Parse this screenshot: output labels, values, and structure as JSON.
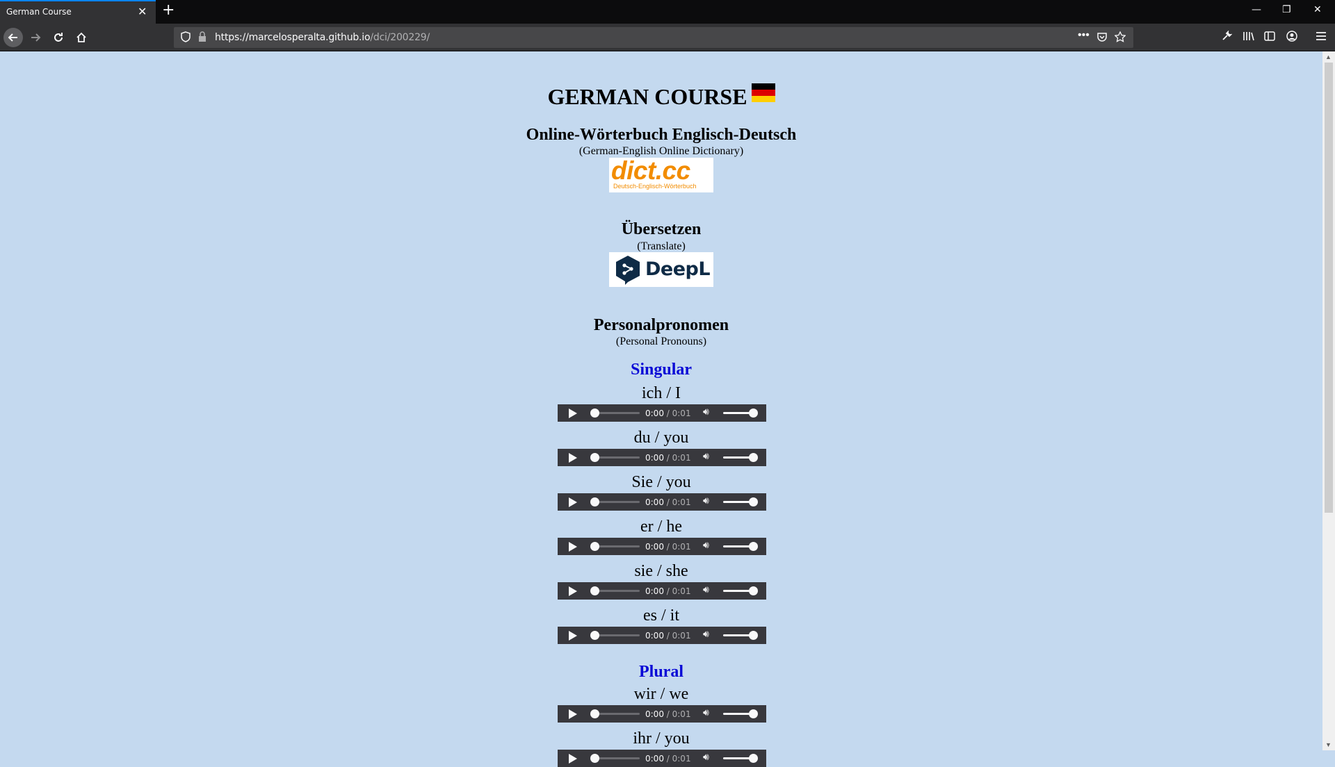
{
  "browser": {
    "tab_title": "German Course",
    "url_host": "https://marcelosperalta.github.io",
    "url_path": "/dci/200229/"
  },
  "page": {
    "title": "GERMAN COURSE",
    "dictionary": {
      "heading": "Online-Wörterbuch Englisch-Deutsch",
      "subtitle": "(German-English Online Dictionary)",
      "logo_text": "dict.cc",
      "logo_subtext": "Deutsch-Englisch-Wörterbuch"
    },
    "translate": {
      "heading": "Übersetzen",
      "subtitle": "(Translate)",
      "logo_text": "DeepL"
    },
    "pronouns": {
      "heading": "Personalpronomen",
      "subtitle": "(Personal Pronouns)",
      "singular_label": "Singular",
      "plural_label": "Plural",
      "singular": [
        {
          "text": "ich / I",
          "current": "0:00",
          "duration": "0:01"
        },
        {
          "text": "du / you",
          "current": "0:00",
          "duration": "0:01"
        },
        {
          "text": "Sie / you",
          "current": "0:00",
          "duration": "0:01"
        },
        {
          "text": "er / he",
          "current": "0:00",
          "duration": "0:01"
        },
        {
          "text": "sie / she",
          "current": "0:00",
          "duration": "0:01"
        },
        {
          "text": "es / it",
          "current": "0:00",
          "duration": "0:01"
        }
      ],
      "plural": [
        {
          "text": "wir / we",
          "current": "0:00",
          "duration": "0:01"
        },
        {
          "text": "ihr / you",
          "current": "0:00",
          "duration": "0:01"
        }
      ]
    }
  },
  "colors": {
    "page_background": "#c4d9ef",
    "section_blue": "#0a0ad6",
    "dict_orange": "#f28c00",
    "deepl_navy": "#0f2b46"
  }
}
